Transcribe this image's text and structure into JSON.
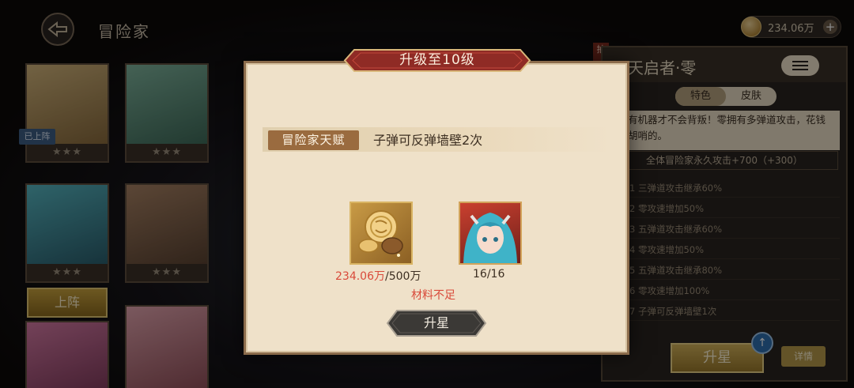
{
  "header": {
    "title": "冒险家",
    "currency": "234.06万"
  },
  "roster": {
    "on_team_tag": "已上阵",
    "deploy_button": "上阵",
    "stars": "★★★"
  },
  "hero_panel": {
    "side_tag": "抽",
    "name": "天启者·零",
    "tabs": [
      "特色",
      "皮肤"
    ],
    "description": "有机器才不会背叛！零拥有多弹道攻击，花钱胡哨的。",
    "bonus": "全体冒险家永久攻击+700（+300）",
    "star_rows": [
      "1 三弹道攻击继承60%",
      "2 零攻速增加50%",
      "3 五弹道攻击继承60%",
      "4 零攻速增加50%",
      "5 五弹道攻击继承80%",
      "6 零攻速增加100%",
      "7 子弹可反弹墙壁1次"
    ],
    "star_button": "升星",
    "detail_button": "详情"
  },
  "modal": {
    "title": "升级至10级",
    "talent_tag": "冒险家天赋",
    "talent_text": "子弹可反弹墙壁2次",
    "coin_have": "234.06万",
    "coin_need": "/500万",
    "hero_count": "16/16",
    "warning": "材料不足",
    "confirm_button": "升星"
  },
  "colors": {
    "dialog_bg": "#efe1c9",
    "ribbon": "#8f2b25",
    "insufficient": "#d94a3a",
    "talent_tag": "#9a6b3f"
  }
}
